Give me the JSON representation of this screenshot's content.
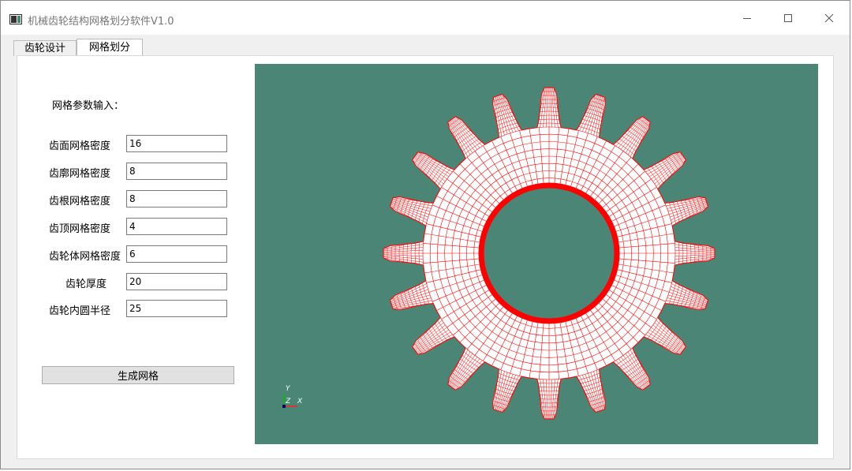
{
  "window": {
    "title": "机械齿轮结构网格划分软件V1.0"
  },
  "tabs": [
    {
      "label": "齿轮设计"
    },
    {
      "label": "网格划分"
    }
  ],
  "form": {
    "section_title": "网格参数输入：",
    "fields": [
      {
        "label": "齿面网格密度",
        "value": "16"
      },
      {
        "label": "齿廓网格密度",
        "value": "8"
      },
      {
        "label": "齿根网格密度",
        "value": "8"
      },
      {
        "label": "齿顶网格密度",
        "value": "4"
      },
      {
        "label": "齿轮体网格密度",
        "value": "6"
      },
      {
        "label": "齿轮厚度",
        "value": "20"
      },
      {
        "label": "齿轮内圆半径",
        "value": "25"
      }
    ],
    "generate_label": "生成网格"
  },
  "viewport": {
    "background": "#4a8575",
    "mesh_color": "#ff0000",
    "gear_teeth": 20,
    "axes": {
      "y": "Y",
      "z": "Z",
      "x": "X"
    }
  }
}
